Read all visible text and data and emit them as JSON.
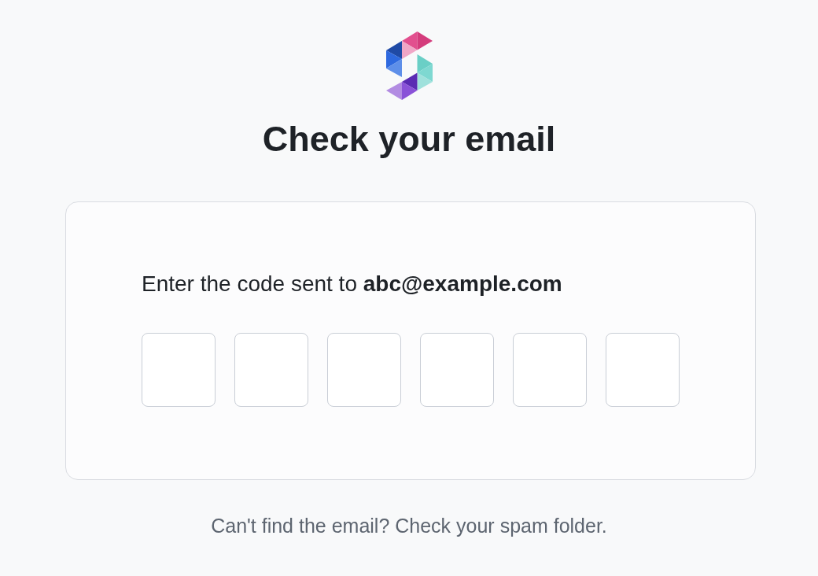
{
  "title": "Check your email",
  "card": {
    "prompt": "Enter the code sent to **abc@example.com**",
    "code_fields": [
      {
        "focused": false
      },
      {
        "focused": false
      },
      {
        "focused": false
      },
      {
        "focused": false
      },
      {
        "focused": false
      },
      {
        "focused": false
      }
    ]
  },
  "footer_note": "Can't find the email? Check your spam folder."
}
